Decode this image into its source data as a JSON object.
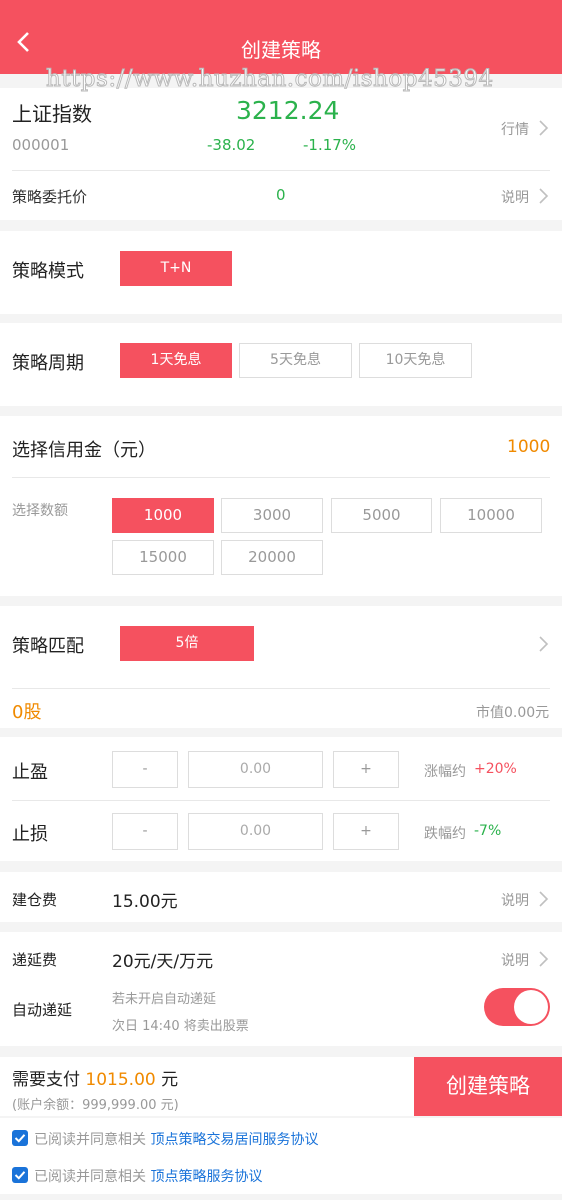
{
  "header": {
    "title": "创建策略",
    "watermark": "https://www.huzhan.com/ishop45394"
  },
  "index": {
    "name": "上证指数",
    "code": "000001",
    "price": "3212.24",
    "change": "-38.02",
    "change_pct": "-1.17%",
    "market_link": "行情"
  },
  "entrust": {
    "label": "策略委托价",
    "value": "0",
    "help": "说明"
  },
  "mode": {
    "label": "策略模式",
    "options": [
      "T+N"
    ]
  },
  "period": {
    "label": "策略周期",
    "options": [
      "1天免息",
      "5天免息",
      "10天免息"
    ]
  },
  "credit": {
    "label": "选择信用金（元）",
    "value": "1000",
    "amount_label": "选择数额",
    "options": [
      "1000",
      "3000",
      "5000",
      "10000",
      "15000",
      "20000"
    ]
  },
  "match": {
    "label": "策略匹配",
    "option": "5倍",
    "shares": "0股",
    "market_value": "市值0.00元"
  },
  "take_profit": {
    "label": "止盈",
    "minus": "-",
    "value": "0.00",
    "plus": "+",
    "note_label": "涨幅约",
    "note_value": "+20%"
  },
  "stop_loss": {
    "label": "止损",
    "minus": "-",
    "value": "0.00",
    "plus": "+",
    "note_label": "跌幅约",
    "note_value": "-7%"
  },
  "fees": {
    "build_label": "建仓费",
    "build_value": "15.00元",
    "build_help": "说明",
    "defer_label": "递延费",
    "defer_value": "20元/天/万元",
    "defer_help": "说明",
    "auto_label": "自动递延",
    "auto_note1": "若未开启自动递延",
    "auto_note2": "次日 14:40 将卖出股票"
  },
  "payment": {
    "label": "需要支付",
    "amount": "1015.00",
    "unit": "元",
    "balance": "(账户余额：999,999.00 元)",
    "submit": "创建策略"
  },
  "agreements": [
    {
      "prefix": "已阅读并同意相关",
      "link": "顶点策略交易居间服务协议"
    },
    {
      "prefix": "已阅读并同意相关",
      "link": "顶点策略服务协议"
    }
  ],
  "colors": {
    "brand": "#f5515f",
    "rise": "#f5515f",
    "fall": "#2bb24c",
    "highlight": "#f08a00",
    "link": "#1a73d9"
  }
}
